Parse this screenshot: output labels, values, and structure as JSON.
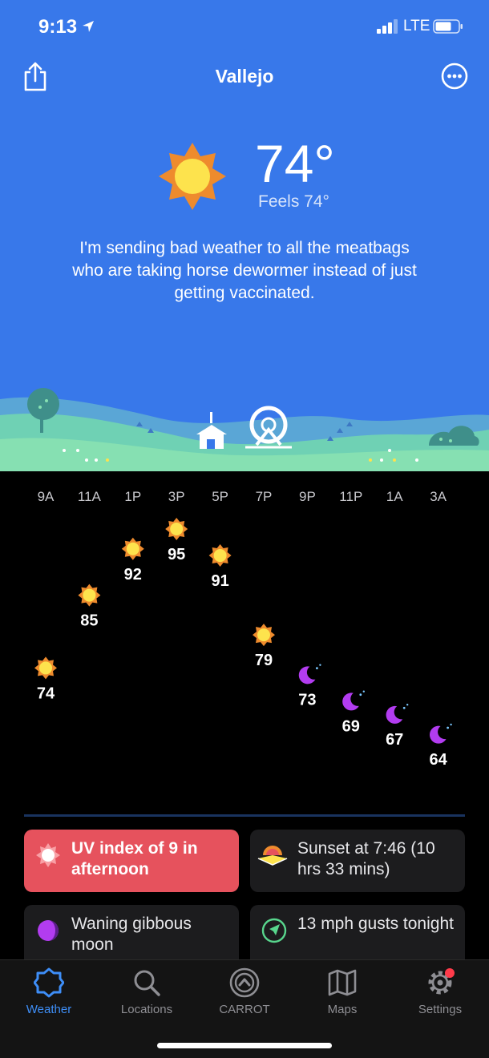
{
  "status_bar": {
    "time": "9:13",
    "network": "LTE"
  },
  "header": {
    "city": "Vallejo"
  },
  "current": {
    "temperature": "74°",
    "feels_like": "Feels 74°",
    "message": "I'm sending bad weather to all the meatbags who are taking horse dewormer instead of just getting vaccinated."
  },
  "forecast": {
    "time_labels": [
      "9A",
      "11A",
      "1P",
      "3P",
      "5P",
      "7P",
      "9P",
      "11P",
      "1A",
      "3A"
    ],
    "hours": [
      {
        "icon": "sun-icon",
        "temp": 74
      },
      {
        "icon": "sun-icon",
        "temp": 85
      },
      {
        "icon": "sun-icon",
        "temp": 92
      },
      {
        "icon": "sun-icon",
        "temp": 95
      },
      {
        "icon": "sun-icon",
        "temp": 91
      },
      {
        "icon": "sun-icon",
        "temp": 79
      },
      {
        "icon": "moon-icon",
        "temp": 73
      },
      {
        "icon": "moon-icon",
        "temp": 69
      },
      {
        "icon": "moon-icon",
        "temp": 67
      },
      {
        "icon": "moon-icon",
        "temp": 64
      }
    ]
  },
  "cards": {
    "uv": "UV index of 9 in afternoon",
    "sunset": "Sunset at 7:46 (10 hrs 33 mins)",
    "moon": "Waning gibbous moon",
    "wind": "13 mph gusts tonight"
  },
  "tabs": [
    {
      "label": "Weather",
      "icon": "weather-icon"
    },
    {
      "label": "Locations",
      "icon": "search-icon"
    },
    {
      "label": "CARROT",
      "icon": "carrot-icon"
    },
    {
      "label": "Maps",
      "icon": "map-icon"
    },
    {
      "label": "Settings",
      "icon": "gear-icon"
    }
  ],
  "colors": {
    "sky": "#3878ea",
    "sun_outer": "#ee8b2d",
    "sun_inner": "#fde34d",
    "moon": "#b23cf0",
    "uv_card": "#e6525d",
    "active_tab": "#3e8ef7"
  }
}
